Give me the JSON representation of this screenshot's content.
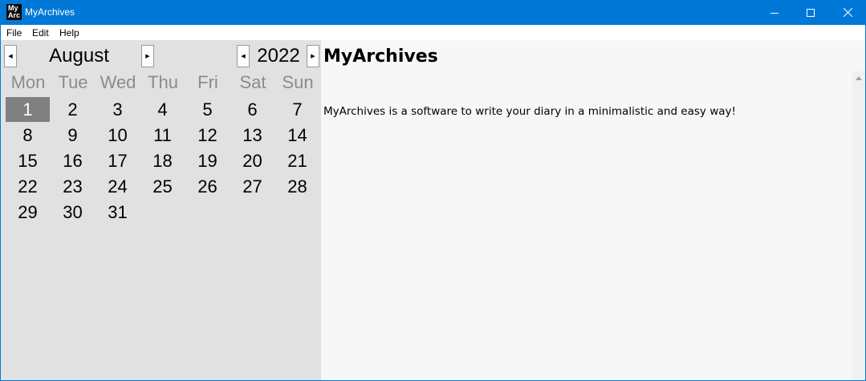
{
  "window": {
    "icon_text_line1": "My",
    "icon_text_line2": "Arc",
    "title": "MyArchives",
    "accent_color": "#0078d7"
  },
  "menu": {
    "file": "File",
    "edit": "Edit",
    "help": "Help"
  },
  "calendar": {
    "month": "August",
    "year": "2022",
    "weekdays": [
      "Mon",
      "Tue",
      "Wed",
      "Thu",
      "Fri",
      "Sat",
      "Sun"
    ],
    "days": [
      "1",
      "2",
      "3",
      "4",
      "5",
      "6",
      "7",
      "8",
      "9",
      "10",
      "11",
      "12",
      "13",
      "14",
      "15",
      "16",
      "17",
      "18",
      "19",
      "20",
      "21",
      "22",
      "23",
      "24",
      "25",
      "26",
      "27",
      "28",
      "29",
      "30",
      "31"
    ],
    "selected_day": "1"
  },
  "content": {
    "heading": "MyArchives",
    "description": "MyArchives is a software to write your diary in a minimalistic and easy way!"
  }
}
